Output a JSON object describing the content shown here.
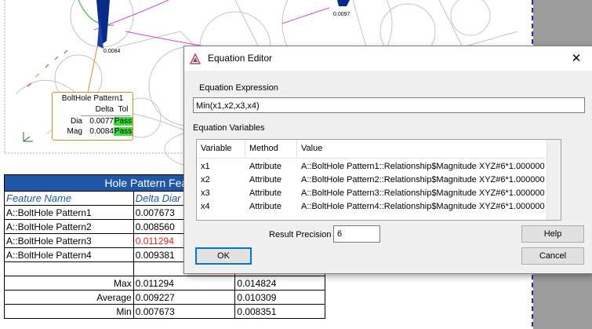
{
  "viewport": {
    "labels": {
      "label_top_right": "0.0097",
      "label_left": "0.0084"
    }
  },
  "callout": {
    "title": "BoltHole Pattern1",
    "headers": {
      "delta": "Delta",
      "tol": "Tol"
    },
    "rows": [
      {
        "name": "Dia",
        "delta": "0.0077",
        "tol": "Pass"
      },
      {
        "name": "Mag",
        "delta": "0.0084",
        "tol": "Pass"
      }
    ],
    "pass_color": "#3ddc3d"
  },
  "results": {
    "title": "Hole Pattern Feature Siz",
    "headers": [
      "Feature Name",
      "Delta Diar",
      ""
    ],
    "rows": [
      {
        "name": "A::BoltHole Pattern1",
        "delta": "0.007673",
        "mag": ""
      },
      {
        "name": "A::BoltHole Pattern2",
        "delta": "0.008560",
        "mag": ""
      },
      {
        "name": "A::BoltHole Pattern3",
        "delta": "0.011294",
        "mag": "",
        "highlight": true
      },
      {
        "name": "A::BoltHole Pattern4",
        "delta": "0.009381",
        "mag": ""
      }
    ],
    "summary": [
      {
        "label": "Max",
        "delta": "0.011294",
        "mag": "0.014824"
      },
      {
        "label": "Average",
        "delta": "0.009227",
        "mag": "0.010309"
      },
      {
        "label": "Min",
        "delta": "0.007673",
        "mag": "0.008351"
      }
    ],
    "title_color": "#1f57a6",
    "highlight_color": "#e02020"
  },
  "dialog": {
    "title": "Equation Editor",
    "close_label": "✕",
    "expression_label": "Equation Expression",
    "expression": "Min(x1,x2,x3,x4)",
    "variables_label": "Equation Variables",
    "columns": [
      "Variable",
      "Method",
      "Value"
    ],
    "variables": [
      {
        "variable": "x1",
        "method": "Attribute",
        "value": "A::BoltHole Pattern1::Relationship$Magnitude XYZ#6*1.000000"
      },
      {
        "variable": "x2",
        "method": "Attribute",
        "value": "A::BoltHole Pattern2::Relationship$Magnitude XYZ#6*1.000000"
      },
      {
        "variable": "x3",
        "method": "Attribute",
        "value": "A::BoltHole Pattern3::Relationship$Magnitude XYZ#6*1.000000"
      },
      {
        "variable": "x4",
        "method": "Attribute",
        "value": "A::BoltHole Pattern4::Relationship$Magnitude XYZ#6*1.000000"
      }
    ],
    "precision_label": "Result Precision",
    "precision_value": "6",
    "help_label": "Help",
    "ok_label": "OK",
    "cancel_label": "Cancel",
    "accent_color": "#0078d7"
  }
}
